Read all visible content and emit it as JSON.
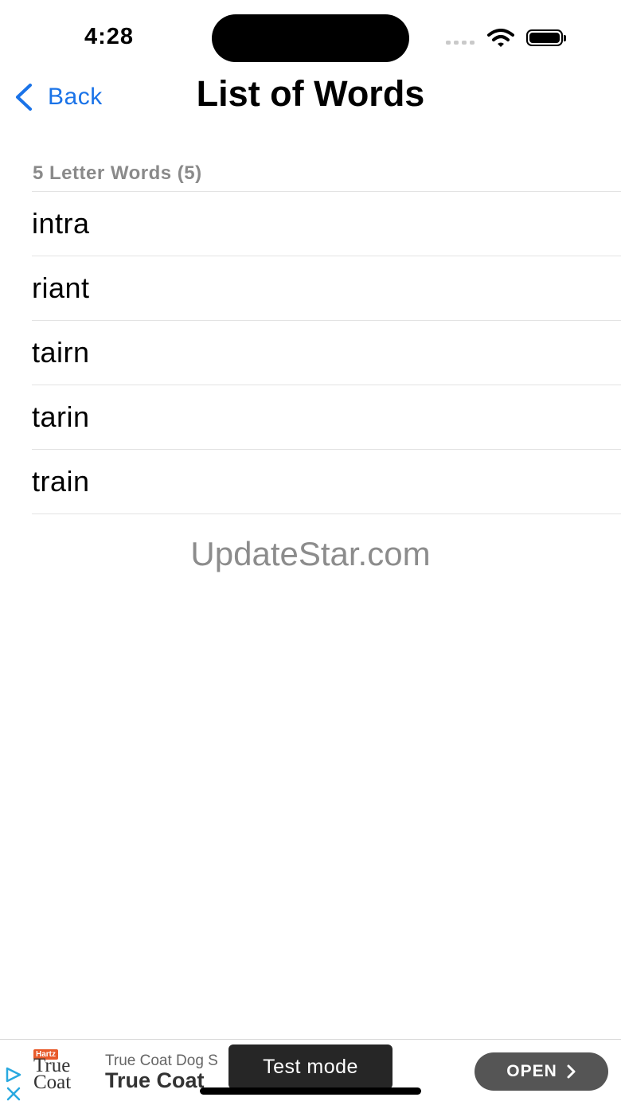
{
  "status": {
    "time": "4:28"
  },
  "nav": {
    "back_label": "Back",
    "title": "List of Words"
  },
  "section": {
    "header": "5 Letter Words (5)"
  },
  "words": [
    "intra",
    "riant",
    "tairn",
    "tarin",
    "train"
  ],
  "watermark": "UpdateStar.com",
  "ad": {
    "logo_badge": "Hartz",
    "logo_text_line1": "True",
    "logo_text_line2": "Coat",
    "subtitle": "True Coat Dog S",
    "title": "True Coat",
    "open_label": "OPEN",
    "test_mode_label": "Test mode"
  },
  "colors": {
    "accent": "#1a73e8",
    "section_header": "#8a8a8a",
    "ad_button": "#555555"
  }
}
